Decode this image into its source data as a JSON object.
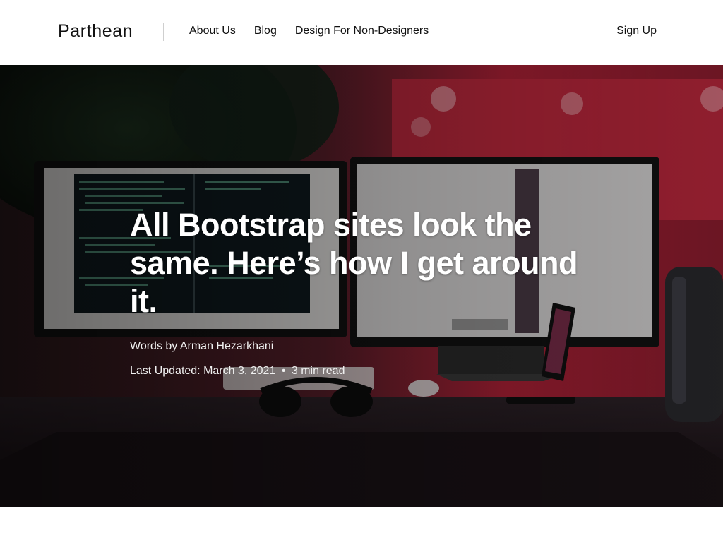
{
  "header": {
    "logo": "Parthean",
    "nav": [
      {
        "label": "About Us"
      },
      {
        "label": "Blog"
      },
      {
        "label": "Design For Non-Designers"
      }
    ],
    "signup_label": "Sign Up"
  },
  "hero": {
    "title": "All Bootstrap sites look the same. Here’s how I get around it.",
    "byline": "Words by Arman Hezarkhani",
    "last_updated": "Last Updated: March 3, 2021",
    "separator": "•",
    "read_time": "3 min read",
    "image": "desk-setup-dual-monitors-photo",
    "colors": {
      "overlay": "#000000",
      "accent_red": "#c7283f",
      "text": "#ffffff"
    }
  }
}
